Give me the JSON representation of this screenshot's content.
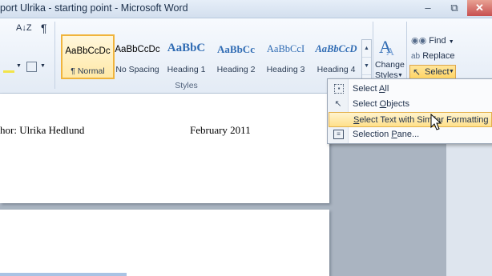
{
  "window": {
    "title": "port Ulrika - starting point - Microsoft Word",
    "controls": {
      "minimize": "–",
      "maximize": "⧉",
      "close": "✕"
    }
  },
  "ribbon": {
    "paragraph_icons": {
      "sort": "A↓Z",
      "pilcrow": "¶"
    },
    "styles": [
      {
        "sample": "AaBbCcDc",
        "name": "¶ Normal",
        "selected": true
      },
      {
        "sample": "AaBbCcDc",
        "name": "No Spacing"
      },
      {
        "sample": "AaBbC",
        "name": "Heading 1"
      },
      {
        "sample": "AaBbCc",
        "name": "Heading 2"
      },
      {
        "sample": "AaBbCcI",
        "name": "Heading 3"
      },
      {
        "sample": "AaBbCcD",
        "name": "Heading 4"
      }
    ],
    "styles_group_label": "Styles",
    "change_styles": {
      "line1": "Change",
      "line2": "Styles"
    },
    "editing": {
      "find": "Find",
      "replace": "Replace",
      "select": "Select"
    }
  },
  "select_menu": {
    "items": [
      {
        "label_pre": "Select ",
        "label_key": "A",
        "label_post": "ll"
      },
      {
        "label_pre": "Select ",
        "label_key": "O",
        "label_post": "bjects"
      },
      {
        "label_pre": "",
        "label_key": "S",
        "label_post": "elect Text with Similar Formatting"
      },
      {
        "label_pre": "Selection ",
        "label_key": "P",
        "label_post": "ane..."
      }
    ]
  },
  "document": {
    "author_line": "hor: Ulrika Hedlund",
    "date": "February 2011"
  },
  "colors": {
    "accent_select": "#ffd25e",
    "highlight_border": "#e3b14c"
  }
}
